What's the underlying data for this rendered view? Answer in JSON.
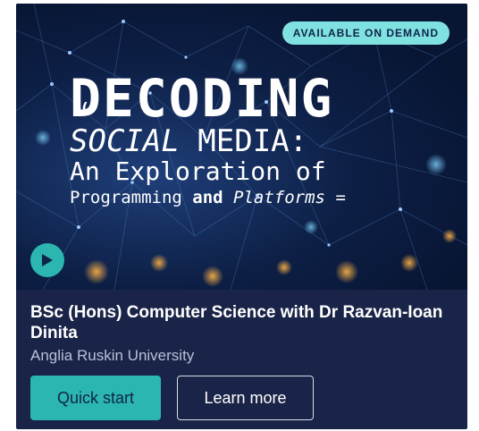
{
  "hero": {
    "badge": "AVAILABLE ON DEMAND",
    "title_line1": "DECODING",
    "title_line2_a": "SOCIAL",
    "title_line2_b": " MEDIA:",
    "title_line3": "An Exploration of",
    "title_line4_a": "Programming ",
    "title_line4_b": "and",
    "title_line4_c": " Platforms",
    "quote_glyph": "((",
    "equals_glyph": "="
  },
  "course": {
    "title": "BSc (Hons) Computer Science with Dr Razvan-Ioan Dinita",
    "university": "Anglia Ruskin University"
  },
  "actions": {
    "quick_start": "Quick start",
    "learn_more": "Learn more"
  },
  "colors": {
    "card_bg": "#1a2448",
    "accent": "#2bb6b0",
    "badge_bg": "#7fe2e0"
  },
  "icons": {
    "play": "play-icon"
  }
}
